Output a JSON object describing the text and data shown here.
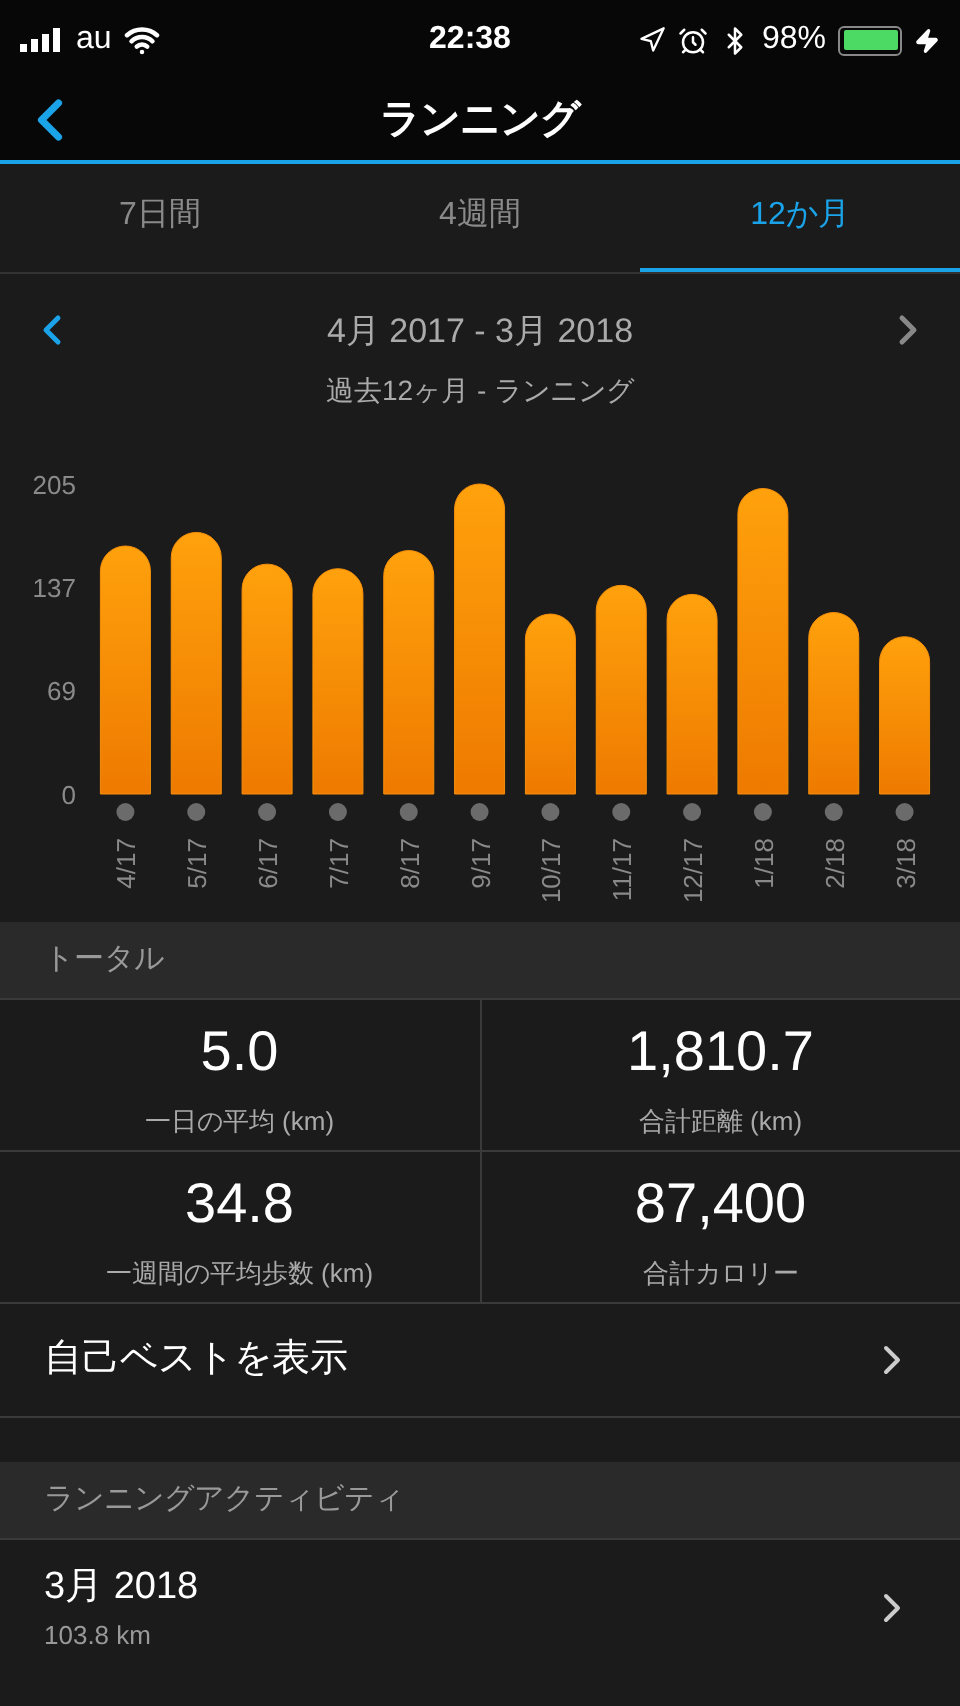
{
  "status_bar": {
    "carrier": "au",
    "time": "22:38",
    "battery": "98%"
  },
  "nav": {
    "title": "ランニング"
  },
  "tabs": [
    {
      "label": "7日間",
      "selected": false
    },
    {
      "label": "4週間",
      "selected": false
    },
    {
      "label": "12か月",
      "selected": true
    }
  ],
  "period": {
    "range": "4月 2017 - 3月 2018",
    "subtitle": "過去12ヶ月 - ランニング"
  },
  "chart_data": {
    "type": "bar",
    "categories": [
      "4/17",
      "5/17",
      "6/17",
      "7/17",
      "8/17",
      "9/17",
      "10/17",
      "11/17",
      "12/17",
      "1/18",
      "2/18",
      "3/18"
    ],
    "series": [
      {
        "color": "#f7900a",
        "values": [
          164,
          173,
          152,
          149,
          161,
          205,
          119,
          138,
          132,
          202,
          120,
          104
        ]
      }
    ],
    "ylim": [
      0,
      205
    ],
    "yticks": [
      0,
      69,
      137,
      205
    ]
  },
  "totals": {
    "header": "トータル",
    "stats": [
      {
        "value": "5.0",
        "label": "一日の平均 (km)"
      },
      {
        "value": "1,810.7",
        "label": "合計距離 (km)"
      },
      {
        "value": "34.8",
        "label": "一週間の平均歩数 (km)"
      },
      {
        "value": "87,400",
        "label": "合計カロリー"
      }
    ]
  },
  "best_link": "自己ベストを表示",
  "activities": {
    "header": "ランニングアクティビティ",
    "items": [
      {
        "title": "3月 2018",
        "detail": "103.8 km"
      }
    ]
  }
}
